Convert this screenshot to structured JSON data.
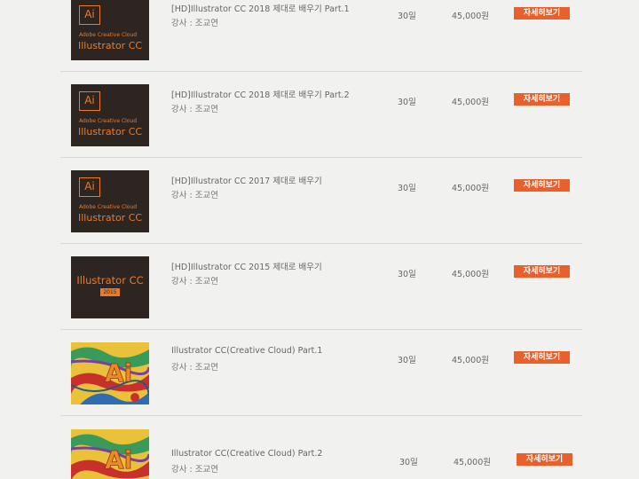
{
  "courses": [
    {
      "thumb": {
        "ai": "Ai",
        "brand": "Adobe Creative Cloud",
        "product": "Illustrator CC"
      },
      "title": "[HD]Illustrator CC 2018 제대로 배우기 Part.1",
      "teacher": "강사 : 조교연",
      "days": "30일",
      "price": "45,000원",
      "button": "자세히보기"
    },
    {
      "thumb": {
        "ai": "Ai",
        "brand": "Adobe Creative Cloud",
        "product": "Illustrator CC"
      },
      "title": "[HD]Illustrator CC 2018 제대로 배우기 Part.2",
      "teacher": "강사 : 조교연",
      "days": "30일",
      "price": "45,000원",
      "button": "자세히보기"
    },
    {
      "thumb": {
        "ai": "Ai",
        "brand": "Adobe Creative Cloud",
        "product": "Illustrator CC"
      },
      "title": "[HD]Illustrator CC 2017 제대로 배우기",
      "teacher": "강사 : 조교연",
      "days": "30일",
      "price": "45,000원",
      "button": "자세히보기"
    },
    {
      "thumb": {
        "product": "Illustrator CC",
        "year": "2015"
      },
      "title": "[HD]Illustrator CC 2015 제대로 배우기",
      "teacher": "강사 : 조교연",
      "days": "30일",
      "price": "45,000원",
      "button": "자세히보기"
    },
    {
      "thumb": {
        "ai": "Ai"
      },
      "title": "Illustrator CC(Creative Cloud) Part.1",
      "teacher": "강사 : 조교연",
      "days": "30일",
      "price": "45,000원",
      "button": "자세히보기"
    },
    {
      "thumb": {
        "ai": "Ai"
      },
      "title": "Illustrator CC(Creative Cloud) Part.2",
      "teacher": "강사 : 조교연",
      "days": "30일",
      "price": "45,000원",
      "button": "자세히보기"
    }
  ],
  "colors": {
    "accent": "#e8612c",
    "illustrator_orange": "#ee7a24",
    "thumb_dark": "#2d2521",
    "background": "#f1f1f0"
  }
}
